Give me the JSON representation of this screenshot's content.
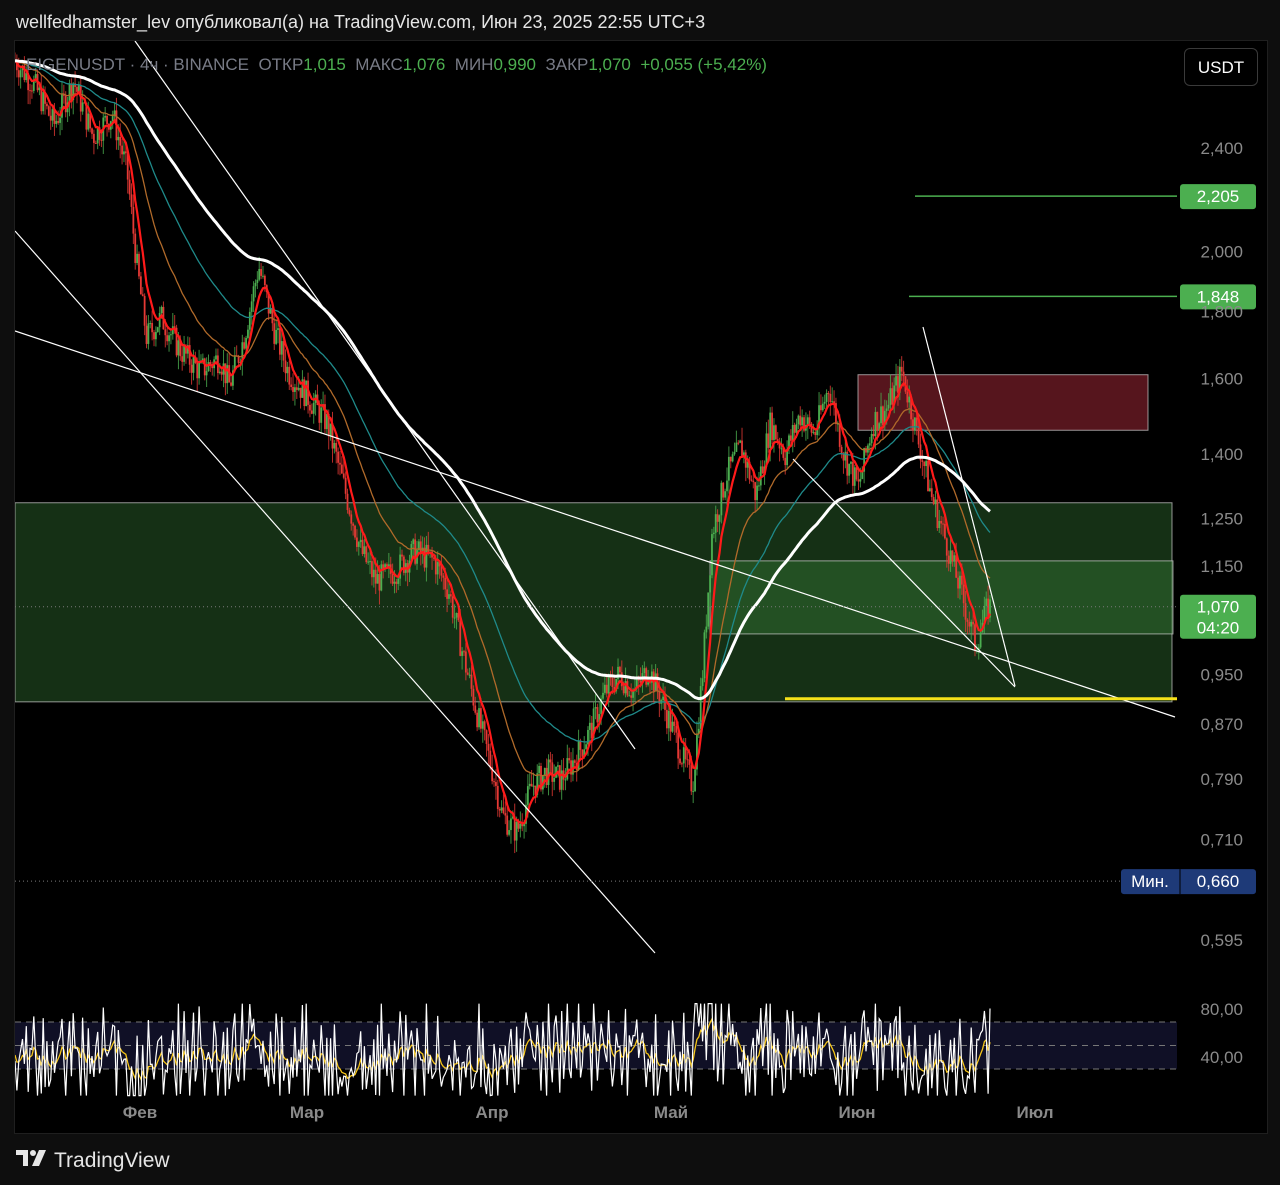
{
  "header": {
    "publisher_line": "wellfedhamster_lev опубликовал(а) на TradingView.com, Июн 23, 2025 22:55 UTC+3"
  },
  "legend": {
    "symbol": "EIGENUSDT",
    "interval": "4ч",
    "exchange": "BINANCE",
    "open_label": "ОТКР",
    "open_value": "1,015",
    "high_label": "МАКС",
    "high_value": "1,076",
    "low_label": "МИН",
    "low_value": "0,990",
    "close_label": "ЗАКР",
    "close_value": "1,070",
    "change": "+0,055 (+5,42%)"
  },
  "currency_button": "USDT",
  "footer": {
    "brand": "TradingView"
  },
  "colors": {
    "background": "#000000",
    "candle_up": "#4caf50",
    "candle_down": "#e53935",
    "ema_fast": "#ff1a1a",
    "ma_slow": "#ffffff",
    "zone_green": "#2f6b2f",
    "zone_red": "#6b1a24",
    "support_line": "#f5e11a",
    "target_green": "#4caf50",
    "rsi_line": "#ffffff",
    "rsi_signal": "#f5c518",
    "min_badge": "#1e3a78"
  },
  "chart_data": {
    "type": "candlestick",
    "title": "",
    "scale": "log",
    "ylim": [
      0.56,
      2.75
    ],
    "x_ticks": [
      "Фев",
      "Мар",
      "Апр",
      "Май",
      "Июн",
      "Июл"
    ],
    "y_ticks": [
      "2,400",
      "2,000",
      "1,800",
      "1,600",
      "1,400",
      "1,250",
      "1,150",
      "1,070",
      "0,950",
      "0,870",
      "0,790",
      "0,710",
      "0,660",
      "0,595"
    ],
    "last_price": {
      "value": 1.07,
      "label": "1,070",
      "countdown": "04:20"
    },
    "min_marker": {
      "label": "Мин.",
      "value": 0.66,
      "value_label": "0,660"
    },
    "target_levels": [
      {
        "value": 2.205,
        "label": "2,205"
      },
      {
        "value": 1.848,
        "label": "1,848"
      }
    ],
    "zones": [
      {
        "kind": "support",
        "from": 0.905,
        "to": 1.285
      },
      {
        "kind": "demand",
        "from": 1.02,
        "to": 1.16
      },
      {
        "kind": "resistance",
        "from": 1.46,
        "to": 1.61
      }
    ],
    "support_line": 0.91,
    "price_path": [
      [
        0.0,
        2.8
      ],
      [
        0.02,
        2.68
      ],
      [
        0.04,
        2.5
      ],
      [
        0.06,
        2.7
      ],
      [
        0.08,
        2.45
      ],
      [
        0.1,
        2.55
      ],
      [
        0.115,
        2.3
      ],
      [
        0.125,
        1.95
      ],
      [
        0.135,
        1.72
      ],
      [
        0.15,
        1.78
      ],
      [
        0.17,
        1.68
      ],
      [
        0.19,
        1.62
      ],
      [
        0.21,
        1.66
      ],
      [
        0.22,
        1.58
      ],
      [
        0.235,
        1.72
      ],
      [
        0.25,
        1.95
      ],
      [
        0.265,
        1.75
      ],
      [
        0.28,
        1.62
      ],
      [
        0.3,
        1.55
      ],
      [
        0.32,
        1.48
      ],
      [
        0.34,
        1.3
      ],
      [
        0.355,
        1.18
      ],
      [
        0.37,
        1.12
      ],
      [
        0.39,
        1.14
      ],
      [
        0.41,
        1.18
      ],
      [
        0.43,
        1.16
      ],
      [
        0.445,
        1.1
      ],
      [
        0.46,
        0.98
      ],
      [
        0.475,
        0.88
      ],
      [
        0.49,
        0.8
      ],
      [
        0.5,
        0.74
      ],
      [
        0.515,
        0.72
      ],
      [
        0.53,
        0.78
      ],
      [
        0.545,
        0.8
      ],
      [
        0.56,
        0.79
      ],
      [
        0.575,
        0.82
      ],
      [
        0.59,
        0.86
      ],
      [
        0.605,
        0.92
      ],
      [
        0.62,
        0.95
      ],
      [
        0.635,
        0.92
      ],
      [
        0.65,
        0.96
      ],
      [
        0.665,
        0.9
      ],
      [
        0.68,
        0.84
      ],
      [
        0.695,
        0.78
      ],
      [
        0.705,
        0.95
      ],
      [
        0.715,
        1.22
      ],
      [
        0.73,
        1.35
      ],
      [
        0.745,
        1.42
      ],
      [
        0.76,
        1.3
      ],
      [
        0.775,
        1.48
      ],
      [
        0.79,
        1.4
      ],
      [
        0.805,
        1.5
      ],
      [
        0.82,
        1.45
      ],
      [
        0.835,
        1.58
      ],
      [
        0.85,
        1.4
      ],
      [
        0.865,
        1.32
      ],
      [
        0.88,
        1.48
      ],
      [
        0.895,
        1.52
      ],
      [
        0.91,
        1.62
      ],
      [
        0.925,
        1.45
      ],
      [
        0.94,
        1.3
      ],
      [
        0.955,
        1.2
      ],
      [
        0.97,
        1.1
      ],
      [
        0.985,
        1.0
      ],
      [
        0.998,
        1.07
      ]
    ]
  }
}
